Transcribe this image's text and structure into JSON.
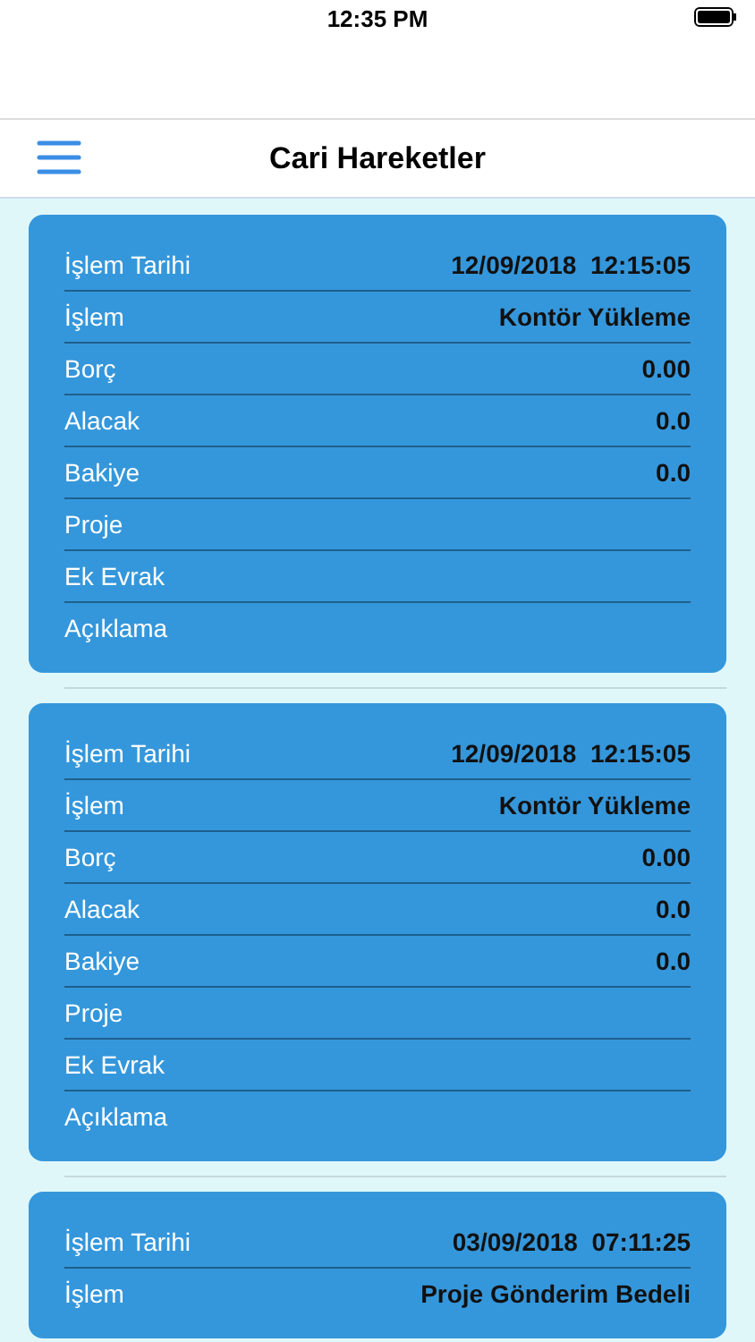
{
  "status_bar": {
    "time": "12:35 PM"
  },
  "nav_bar": {
    "title": "Cari Hareketler"
  },
  "cards": [
    {
      "rows": [
        {
          "label": "İşlem Tarihi",
          "value": "12/09/2018  12:15:05"
        },
        {
          "label": "İşlem",
          "value": "Kontör Yükleme"
        },
        {
          "label": "Borç",
          "value": "0.00"
        },
        {
          "label": "Alacak",
          "value": "0.0"
        },
        {
          "label": "Bakiye",
          "value": "0.0"
        },
        {
          "label": "Proje"
        },
        {
          "label": "Ek Evrak"
        },
        {
          "label": "Açıklama"
        }
      ]
    },
    {
      "rows": [
        {
          "label": "İşlem Tarihi",
          "value": "12/09/2018  12:15:05"
        },
        {
          "label": "İşlem",
          "value": "Kontör Yükleme"
        },
        {
          "label": "Borç",
          "value": "0.00"
        },
        {
          "label": "Alacak",
          "value": "0.0"
        },
        {
          "label": "Bakiye",
          "value": "0.0"
        },
        {
          "label": "Proje"
        },
        {
          "label": "Ek Evrak"
        },
        {
          "label": "Açıklama"
        }
      ]
    },
    {
      "rows": [
        {
          "label": "İşlem Tarihi",
          "value": "03/09/2018  07:11:25"
        },
        {
          "label": "İşlem",
          "value": "Proje Gönderim Bedeli"
        }
      ]
    }
  ]
}
